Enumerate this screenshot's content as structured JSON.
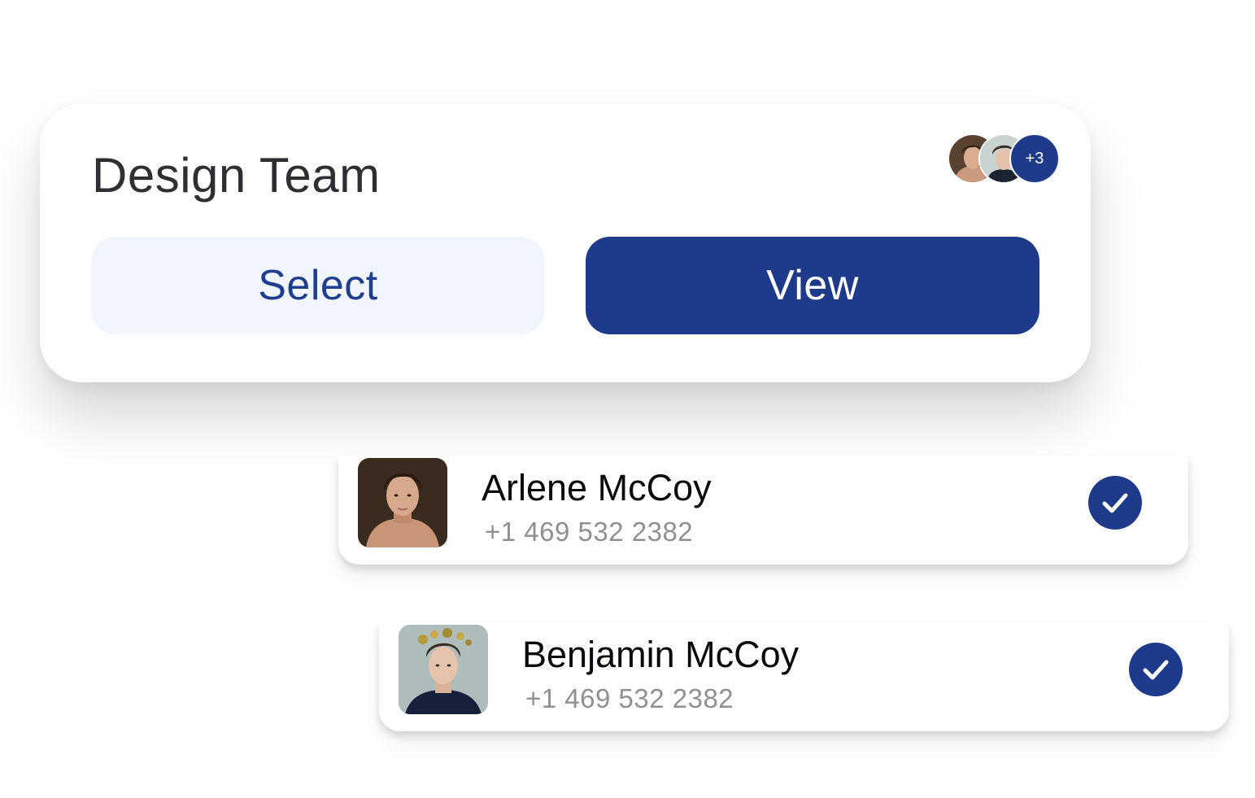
{
  "colors": {
    "primary": "#1e3a8a",
    "primary_text": "#1f3f8e",
    "secondary_bg": "#f1f6fe",
    "title_text": "#2e2e33",
    "phone_text": "#8f8f95"
  },
  "team_card": {
    "title": "Design Team",
    "members": {
      "avatars": [
        "person-photo-1",
        "person-photo-2"
      ],
      "more_count": "+3"
    },
    "select_label": "Select",
    "view_label": "View"
  },
  "contacts": [
    {
      "name": "Arlene McCoy",
      "phone": "+1 469 532 2382",
      "photo": "person-photo",
      "selected_icon": "check-icon"
    },
    {
      "name": "Benjamin McCoy",
      "phone": "+1 469 532 2382",
      "photo": "person-photo",
      "selected_icon": "check-icon"
    }
  ]
}
